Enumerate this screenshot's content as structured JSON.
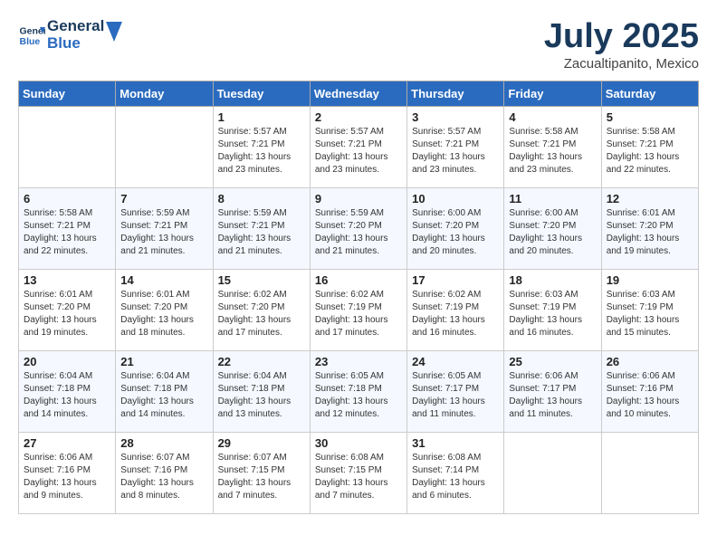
{
  "header": {
    "logo_line1": "General",
    "logo_line2": "Blue",
    "month": "July 2025",
    "location": "Zacualtipanito, Mexico"
  },
  "weekdays": [
    "Sunday",
    "Monday",
    "Tuesday",
    "Wednesday",
    "Thursday",
    "Friday",
    "Saturday"
  ],
  "weeks": [
    [
      {
        "day": "",
        "info": ""
      },
      {
        "day": "",
        "info": ""
      },
      {
        "day": "1",
        "info": "Sunrise: 5:57 AM\nSunset: 7:21 PM\nDaylight: 13 hours\nand 23 minutes."
      },
      {
        "day": "2",
        "info": "Sunrise: 5:57 AM\nSunset: 7:21 PM\nDaylight: 13 hours\nand 23 minutes."
      },
      {
        "day": "3",
        "info": "Sunrise: 5:57 AM\nSunset: 7:21 PM\nDaylight: 13 hours\nand 23 minutes."
      },
      {
        "day": "4",
        "info": "Sunrise: 5:58 AM\nSunset: 7:21 PM\nDaylight: 13 hours\nand 23 minutes."
      },
      {
        "day": "5",
        "info": "Sunrise: 5:58 AM\nSunset: 7:21 PM\nDaylight: 13 hours\nand 22 minutes."
      }
    ],
    [
      {
        "day": "6",
        "info": "Sunrise: 5:58 AM\nSunset: 7:21 PM\nDaylight: 13 hours\nand 22 minutes."
      },
      {
        "day": "7",
        "info": "Sunrise: 5:59 AM\nSunset: 7:21 PM\nDaylight: 13 hours\nand 21 minutes."
      },
      {
        "day": "8",
        "info": "Sunrise: 5:59 AM\nSunset: 7:21 PM\nDaylight: 13 hours\nand 21 minutes."
      },
      {
        "day": "9",
        "info": "Sunrise: 5:59 AM\nSunset: 7:20 PM\nDaylight: 13 hours\nand 21 minutes."
      },
      {
        "day": "10",
        "info": "Sunrise: 6:00 AM\nSunset: 7:20 PM\nDaylight: 13 hours\nand 20 minutes."
      },
      {
        "day": "11",
        "info": "Sunrise: 6:00 AM\nSunset: 7:20 PM\nDaylight: 13 hours\nand 20 minutes."
      },
      {
        "day": "12",
        "info": "Sunrise: 6:01 AM\nSunset: 7:20 PM\nDaylight: 13 hours\nand 19 minutes."
      }
    ],
    [
      {
        "day": "13",
        "info": "Sunrise: 6:01 AM\nSunset: 7:20 PM\nDaylight: 13 hours\nand 19 minutes."
      },
      {
        "day": "14",
        "info": "Sunrise: 6:01 AM\nSunset: 7:20 PM\nDaylight: 13 hours\nand 18 minutes."
      },
      {
        "day": "15",
        "info": "Sunrise: 6:02 AM\nSunset: 7:20 PM\nDaylight: 13 hours\nand 17 minutes."
      },
      {
        "day": "16",
        "info": "Sunrise: 6:02 AM\nSunset: 7:19 PM\nDaylight: 13 hours\nand 17 minutes."
      },
      {
        "day": "17",
        "info": "Sunrise: 6:02 AM\nSunset: 7:19 PM\nDaylight: 13 hours\nand 16 minutes."
      },
      {
        "day": "18",
        "info": "Sunrise: 6:03 AM\nSunset: 7:19 PM\nDaylight: 13 hours\nand 16 minutes."
      },
      {
        "day": "19",
        "info": "Sunrise: 6:03 AM\nSunset: 7:19 PM\nDaylight: 13 hours\nand 15 minutes."
      }
    ],
    [
      {
        "day": "20",
        "info": "Sunrise: 6:04 AM\nSunset: 7:18 PM\nDaylight: 13 hours\nand 14 minutes."
      },
      {
        "day": "21",
        "info": "Sunrise: 6:04 AM\nSunset: 7:18 PM\nDaylight: 13 hours\nand 14 minutes."
      },
      {
        "day": "22",
        "info": "Sunrise: 6:04 AM\nSunset: 7:18 PM\nDaylight: 13 hours\nand 13 minutes."
      },
      {
        "day": "23",
        "info": "Sunrise: 6:05 AM\nSunset: 7:18 PM\nDaylight: 13 hours\nand 12 minutes."
      },
      {
        "day": "24",
        "info": "Sunrise: 6:05 AM\nSunset: 7:17 PM\nDaylight: 13 hours\nand 11 minutes."
      },
      {
        "day": "25",
        "info": "Sunrise: 6:06 AM\nSunset: 7:17 PM\nDaylight: 13 hours\nand 11 minutes."
      },
      {
        "day": "26",
        "info": "Sunrise: 6:06 AM\nSunset: 7:16 PM\nDaylight: 13 hours\nand 10 minutes."
      }
    ],
    [
      {
        "day": "27",
        "info": "Sunrise: 6:06 AM\nSunset: 7:16 PM\nDaylight: 13 hours\nand 9 minutes."
      },
      {
        "day": "28",
        "info": "Sunrise: 6:07 AM\nSunset: 7:16 PM\nDaylight: 13 hours\nand 8 minutes."
      },
      {
        "day": "29",
        "info": "Sunrise: 6:07 AM\nSunset: 7:15 PM\nDaylight: 13 hours\nand 7 minutes."
      },
      {
        "day": "30",
        "info": "Sunrise: 6:08 AM\nSunset: 7:15 PM\nDaylight: 13 hours\nand 7 minutes."
      },
      {
        "day": "31",
        "info": "Sunrise: 6:08 AM\nSunset: 7:14 PM\nDaylight: 13 hours\nand 6 minutes."
      },
      {
        "day": "",
        "info": ""
      },
      {
        "day": "",
        "info": ""
      }
    ]
  ]
}
